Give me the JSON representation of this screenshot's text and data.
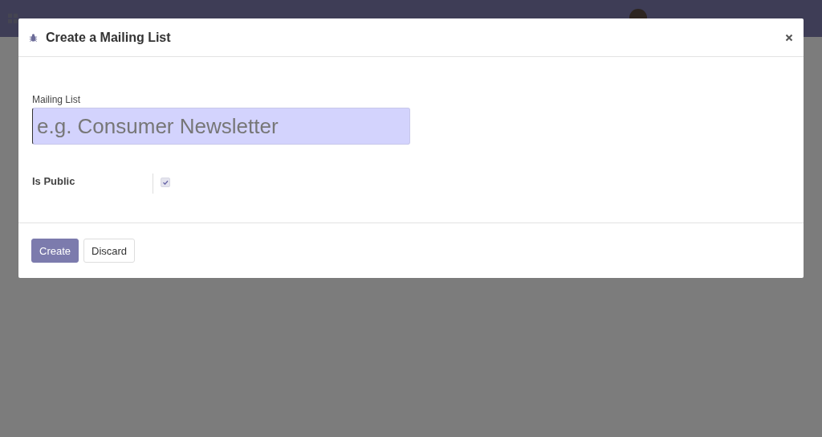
{
  "dialog": {
    "title": "Create a Mailing List",
    "fields": [
      {
        "kind": "text",
        "label": "Mailing List",
        "placeholder": "e.g. Consumer Newsletter"
      },
      {
        "kind": "checkbox",
        "label": "Is Public",
        "checked": true
      }
    ],
    "buttons": [
      {
        "label": "Create",
        "kind": "primary"
      },
      {
        "label": "Discard",
        "kind": "secondary"
      }
    ]
  }
}
